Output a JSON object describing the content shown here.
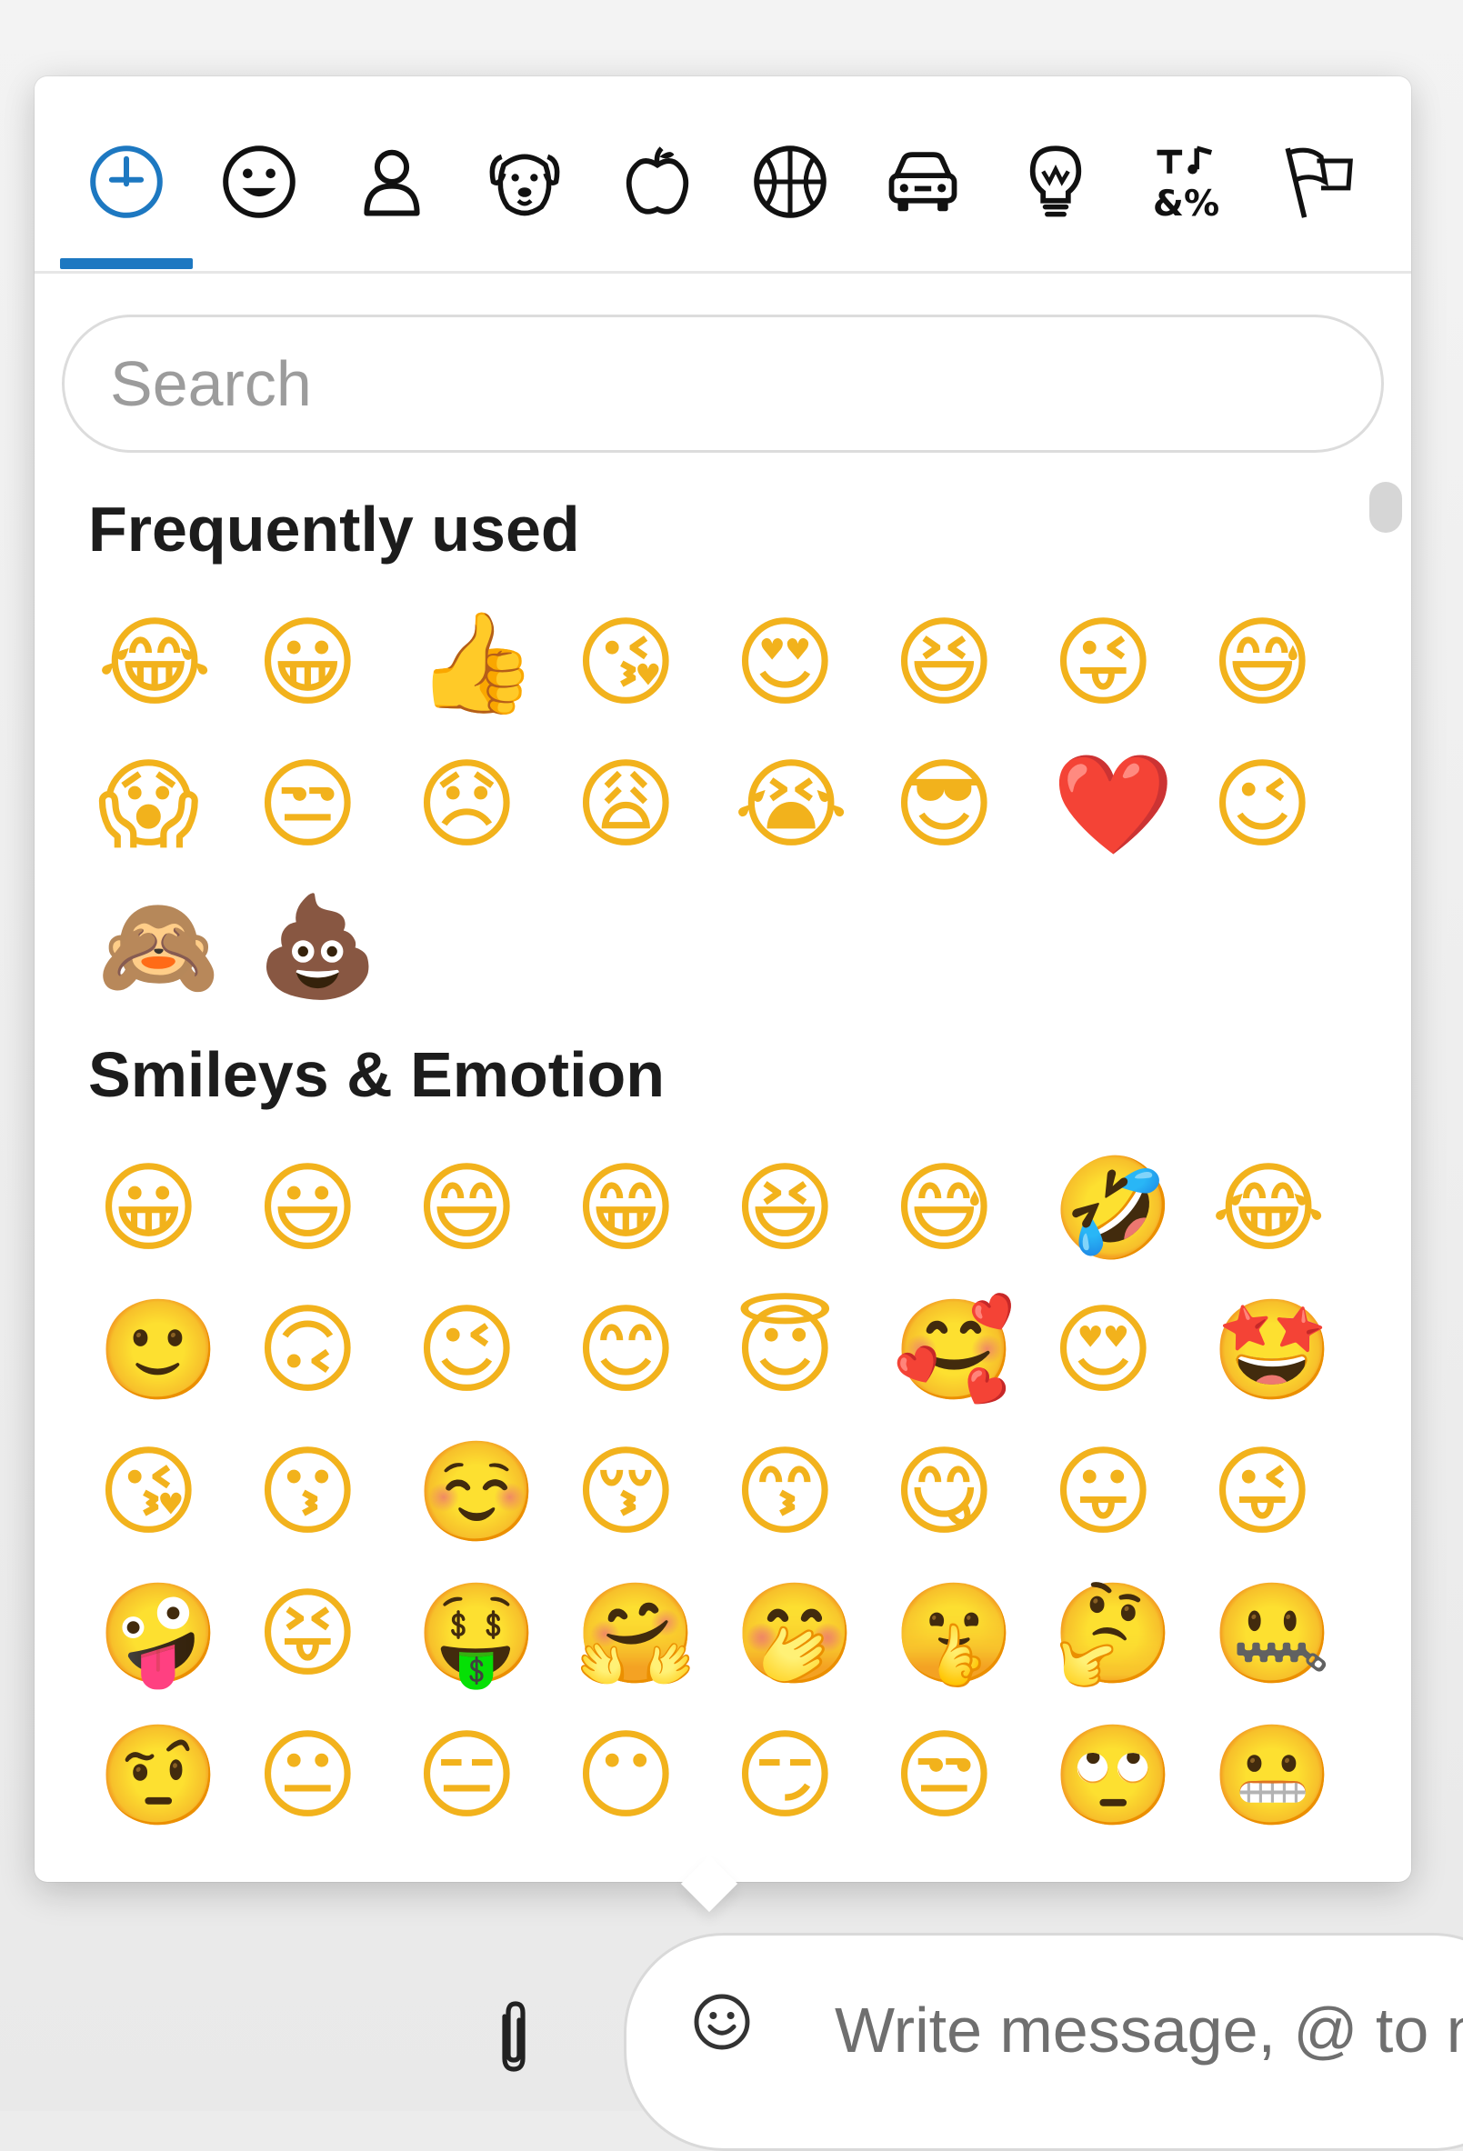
{
  "tabs": [
    {
      "name": "clock-icon"
    },
    {
      "name": "smiley-icon"
    },
    {
      "name": "person-icon"
    },
    {
      "name": "dog-icon"
    },
    {
      "name": "apple-icon"
    },
    {
      "name": "basketball-icon"
    },
    {
      "name": "car-icon"
    },
    {
      "name": "lightbulb-icon"
    },
    {
      "name": "symbols-icon"
    },
    {
      "name": "flags-icon"
    }
  ],
  "active_tab": 0,
  "accent_color": "#1d78c1",
  "search": {
    "placeholder": "Search"
  },
  "sections": {
    "frequent": {
      "title": "Frequently used",
      "emojis": [
        "😂",
        "😀",
        "👍",
        "😘",
        "😍",
        "😆",
        "😜",
        "😅",
        "😱",
        "😒",
        "😞",
        "😩",
        "😭",
        "😎",
        "❤️",
        "😉",
        "🙈",
        "💩"
      ]
    },
    "smileys": {
      "title": "Smileys & Emotion",
      "emojis": [
        "😀",
        "😃",
        "😄",
        "😁",
        "😆",
        "😅",
        "🤣",
        "😂",
        "🙂",
        "🙃",
        "😉",
        "😊",
        "😇",
        "🥰",
        "😍",
        "🤩",
        "😘",
        "😗",
        "☺️",
        "😚",
        "😙",
        "😋",
        "😛",
        "😜",
        "🤪",
        "😝",
        "🤑",
        "🤗",
        "🤭",
        "🤫",
        "🤔",
        "🤐",
        "🤨",
        "😐",
        "😑",
        "😶",
        "😏",
        "😒",
        "🙄",
        "😬"
      ]
    }
  },
  "composer": {
    "attach_icon": "paperclip-icon",
    "emoji_icon": "smiley-icon",
    "placeholder": "Write message, @ to mention"
  }
}
